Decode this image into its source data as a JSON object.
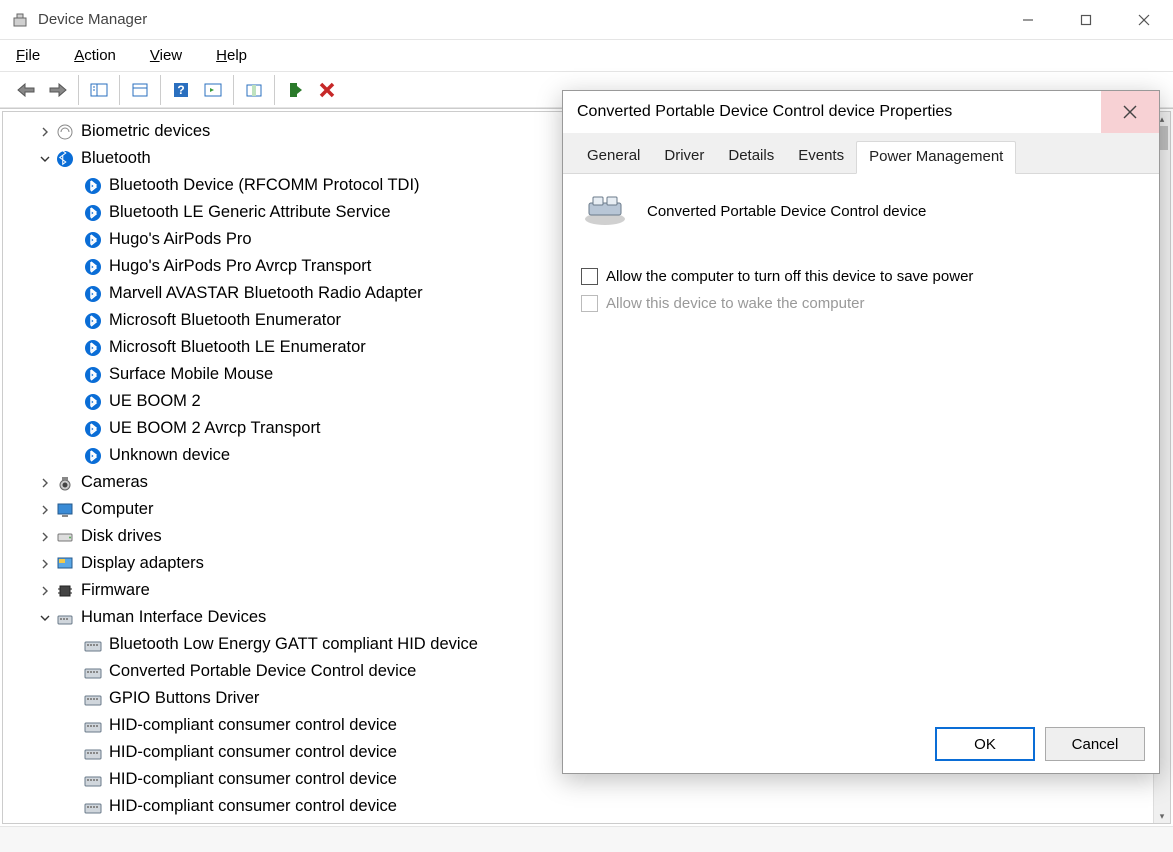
{
  "window": {
    "title": "Device Manager"
  },
  "menu": {
    "file": "File",
    "action": "Action",
    "view": "View",
    "help": "Help"
  },
  "tree": {
    "categories": [
      {
        "name": "Biometric devices",
        "expanded": false,
        "icon": "fingerprint"
      },
      {
        "name": "Bluetooth",
        "expanded": true,
        "icon": "bluetooth",
        "children": [
          "Bluetooth Device (RFCOMM Protocol TDI)",
          "Bluetooth LE Generic Attribute Service",
          "Hugo's AirPods Pro",
          "Hugo's AirPods Pro Avrcp Transport",
          "Marvell AVASTAR Bluetooth Radio Adapter",
          "Microsoft Bluetooth Enumerator",
          "Microsoft Bluetooth LE Enumerator",
          "Surface Mobile Mouse",
          "UE BOOM 2",
          "UE BOOM 2 Avrcp Transport",
          "Unknown device"
        ]
      },
      {
        "name": "Cameras",
        "expanded": false,
        "icon": "camera"
      },
      {
        "name": "Computer",
        "expanded": false,
        "icon": "monitor"
      },
      {
        "name": "Disk drives",
        "expanded": false,
        "icon": "disk"
      },
      {
        "name": "Display adapters",
        "expanded": false,
        "icon": "display"
      },
      {
        "name": "Firmware",
        "expanded": false,
        "icon": "chip"
      },
      {
        "name": "Human Interface Devices",
        "expanded": true,
        "icon": "hid",
        "children": [
          "Bluetooth Low Energy GATT compliant HID device",
          "Converted Portable Device Control device",
          "GPIO Buttons Driver",
          "HID-compliant consumer control device",
          "HID-compliant consumer control device",
          "HID-compliant consumer control device",
          "HID-compliant consumer control device"
        ]
      }
    ]
  },
  "dialog": {
    "title": "Converted Portable Device Control device Properties",
    "tabs": {
      "general": "General",
      "driver": "Driver",
      "details": "Details",
      "events": "Events",
      "power": "Power Management"
    },
    "deviceName": "Converted Portable Device Control device",
    "checkbox1": "Allow the computer to turn off this device to save power",
    "checkbox2": "Allow this device to wake the computer",
    "ok": "OK",
    "cancel": "Cancel"
  }
}
